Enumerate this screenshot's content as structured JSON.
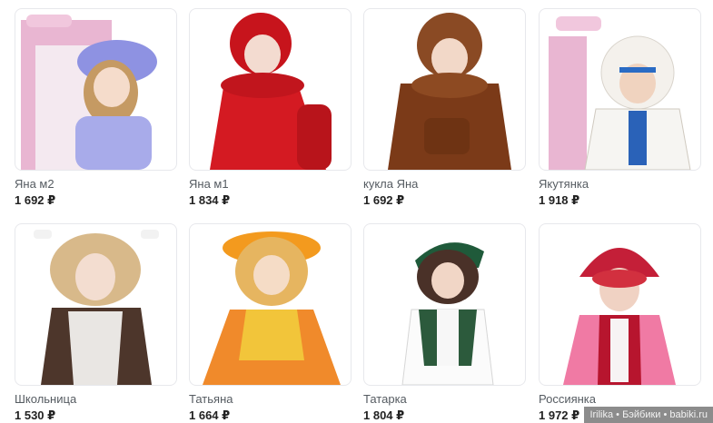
{
  "products": [
    {
      "name": "Яна м2",
      "price": "1 692 ₽"
    },
    {
      "name": "Яна м1",
      "price": "1 834 ₽"
    },
    {
      "name": "кукла Яна",
      "price": "1 692 ₽"
    },
    {
      "name": "Якутянка",
      "price": "1 918 ₽"
    },
    {
      "name": "Школьница",
      "price": "1 530 ₽"
    },
    {
      "name": "Татьяна",
      "price": "1 664 ₽"
    },
    {
      "name": "Татарка",
      "price": "1 804 ₽"
    },
    {
      "name": "Россиянка",
      "price": "1 972 ₽"
    }
  ],
  "watermark": "Irilika • Бэйбики • babiki.ru"
}
